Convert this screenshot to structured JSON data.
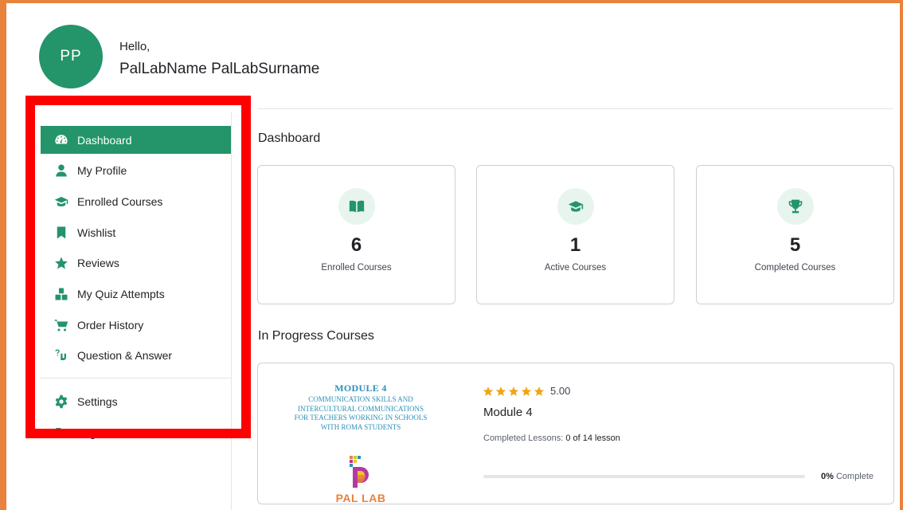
{
  "user": {
    "initials": "PP",
    "greeting": "Hello,",
    "full_name": "PalLabName PalLabSurname"
  },
  "sidebar": {
    "items": [
      {
        "label": "Dashboard",
        "icon": "dashboard-gauge-icon",
        "active": true
      },
      {
        "label": "My Profile",
        "icon": "user-icon"
      },
      {
        "label": "Enrolled Courses",
        "icon": "graduation-cap-icon"
      },
      {
        "label": "Wishlist",
        "icon": "bookmark-icon"
      },
      {
        "label": "Reviews",
        "icon": "star-icon"
      },
      {
        "label": "My Quiz Attempts",
        "icon": "quiz-blocks-icon"
      },
      {
        "label": "Order History",
        "icon": "cart-icon"
      },
      {
        "label": "Question & Answer",
        "icon": "question-answer-icon"
      }
    ],
    "bottom_items": [
      {
        "label": "Settings",
        "icon": "gear-icon"
      },
      {
        "label": "Logout",
        "icon": "logout-icon"
      }
    ]
  },
  "dashboard": {
    "title": "Dashboard",
    "stats": [
      {
        "value": "6",
        "label": "Enrolled Courses",
        "icon": "book-open-icon"
      },
      {
        "value": "1",
        "label": "Active Courses",
        "icon": "graduation-cap-icon"
      },
      {
        "value": "5",
        "label": "Completed Courses",
        "icon": "trophy-icon"
      }
    ]
  },
  "in_progress": {
    "title": "In Progress Courses",
    "course": {
      "thumb_module": "MODULE 4",
      "thumb_lines": [
        "COMMUNICATION SKILLS AND",
        "INTERCULTURAL COMMUNICATIONS",
        "FOR TEACHERS WORKING IN SCHOOLS",
        "WITH ROMA STUDENTS"
      ],
      "thumb_brand": "PAL LAB",
      "stars": 5,
      "rating": "5.00",
      "title": "Module 4",
      "lessons_label": "Completed Lessons:",
      "lessons_value": "0 of 14 lesson",
      "progress_percent": 0,
      "progress_value": "0%",
      "progress_suffix": "Complete"
    }
  },
  "colors": {
    "accent": "#24946a",
    "frame": "#e8823c",
    "highlight": "#ff0000",
    "star": "#f0a519"
  }
}
